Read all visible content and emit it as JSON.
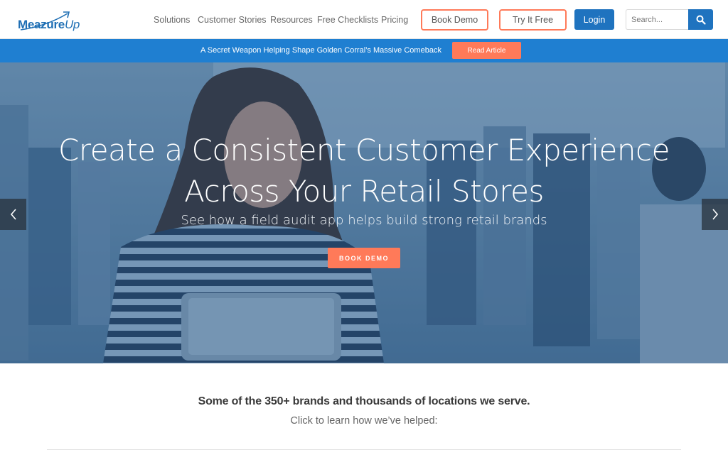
{
  "header": {
    "logo_main": "Meazure",
    "logo_accent": "Up",
    "nav": [
      "Solutions",
      "Customer Stories",
      "Resources",
      "Free Checklists",
      "Pricing"
    ],
    "book_demo": "Book Demo",
    "try_free": "Try It Free",
    "login": "Login",
    "search_placeholder": "Search..."
  },
  "announcement": {
    "text": "A Secret Weapon Helping Shape Golden Corral’s Massive Comeback",
    "button": "Read Article"
  },
  "hero": {
    "title_line1": "Create a Consistent Customer Experience",
    "title_line2": "Across Your Retail Stores",
    "subtitle": "See how a field audit app helps build strong retail brands",
    "cta": "BOOK DEMO"
  },
  "brands": {
    "title": "Some of the 350+ brands and thousands of locations we serve.",
    "subtitle": "Click to learn how we’ve helped:"
  },
  "colors": {
    "brand_blue": "#1f73bf",
    "accent_orange": "#ff7a59",
    "announce_blue": "#1f7fd1"
  }
}
